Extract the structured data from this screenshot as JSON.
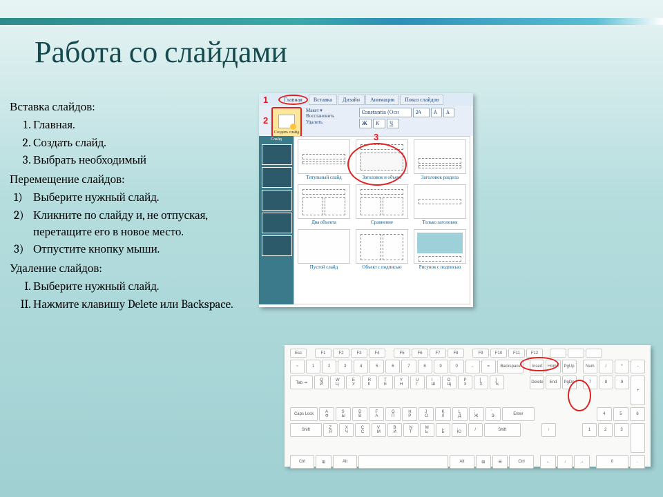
{
  "title": "Работа со слайдами",
  "section1": {
    "head": "Вставка слайдов:",
    "items": [
      "Главная.",
      "Создать слайд.",
      "Выбрать необходимый"
    ]
  },
  "section2": {
    "head": "Перемещение слайдов:",
    "items": [
      "Выберите нужный слайд.",
      "Кликните по слайду и, не отпуская, перетащите его в новое место.",
      "Отпустите кнопку мыши."
    ]
  },
  "section3": {
    "head": "Удаление слайдов:",
    "items": [
      "Выберите нужный слайд.",
      "Нажмите клавишу Delete или Backspace."
    ]
  },
  "paren_markers": [
    "1)",
    "2)",
    "3)"
  ],
  "badges": {
    "b1": "1",
    "b2": "2",
    "b3": "3"
  },
  "ribbon_tabs": {
    "main": "Главная",
    "insert": "Вставка",
    "design": "Дизайн",
    "anim": "Анимация",
    "show": "Показ слайдов"
  },
  "ribbon": {
    "create": "Создать слайд",
    "layout": "Макет ▾",
    "restore": "Восстановить",
    "delete": "Удалить",
    "font": "Constantia (Осн",
    "size": "24"
  },
  "layouts": {
    "l1": "Титульный слайд",
    "l2": "Заголовок и объект",
    "l3": "Заголовок раздела",
    "l4": "Два объекта",
    "l5": "Сравнение",
    "l6": "Только заголовок",
    "l7": "Пустой слайд",
    "l8": "Объект с подписью",
    "l9": "Рисунок с подписью"
  },
  "keys": {
    "esc": "Esc",
    "backspace": "Backspace",
    "tab": "Tab ⇥",
    "caps": "Caps Lock",
    "shift": "Shift",
    "ctrl": "Ctrl",
    "alt": "Alt",
    "enter": "Enter",
    "del": "Delete",
    "ins": "Insert",
    "home": "Home",
    "end": "End",
    "pgup": "PgUp",
    "pgdn": "PgDn",
    "numlk": "Num"
  }
}
